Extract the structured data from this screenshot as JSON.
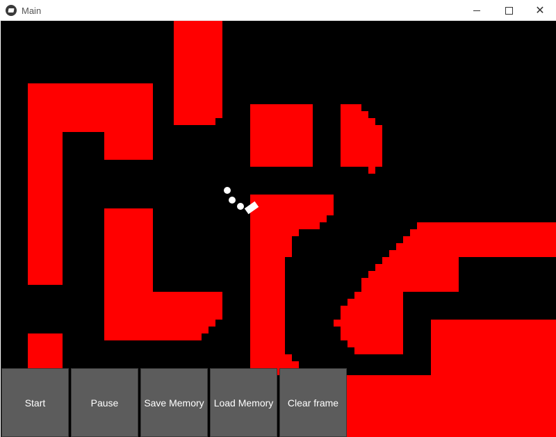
{
  "window": {
    "title": "Main"
  },
  "icons": {
    "app": "kivy-logo-icon",
    "minimize": "minimize-icon",
    "maximize": "maximize-icon",
    "close": "close-icon"
  },
  "colors": {
    "wall": "#ff0000",
    "background": "#000000",
    "agent": "#ffffff",
    "button": "#5c5c5c"
  },
  "controls": {
    "start": "Start",
    "pause": "Pause",
    "save_memory": "Save Memory",
    "load_memory": "Load Memory",
    "clear_frame": "Clear frame"
  }
}
